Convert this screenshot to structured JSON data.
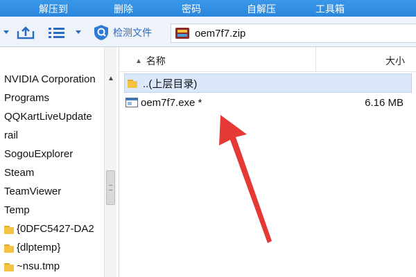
{
  "menubar": {
    "items": [
      "解压到",
      "删除",
      "密码",
      "自解压",
      "工具箱"
    ]
  },
  "toolbar": {
    "detect_file_label": "检测文件",
    "address": "oem7f7.zip"
  },
  "tree": {
    "items": [
      "NVIDIA Corporation",
      "Programs",
      "QQKartLiveUpdate",
      "rail",
      "SogouExplorer",
      "Steam",
      "TeamViewer",
      "Temp",
      "{0DFC5427-DA2",
      "{dlptemp}",
      "~nsu.tmp"
    ],
    "close_glyph": "×"
  },
  "list": {
    "header": {
      "name": "名称",
      "size": "大小"
    },
    "parent_row": "..(上层目录)",
    "files": [
      {
        "name": "oem7f7.exe *",
        "size": "6.16 MB"
      }
    ]
  },
  "colors": {
    "menubar": "#2a86db",
    "selection": "#dbe8fb",
    "annotation_arrow": "#e53935"
  },
  "icons": [
    "shield-icon",
    "zip-archive-icon",
    "folder-icon",
    "exe-file-icon",
    "close-icon"
  ]
}
